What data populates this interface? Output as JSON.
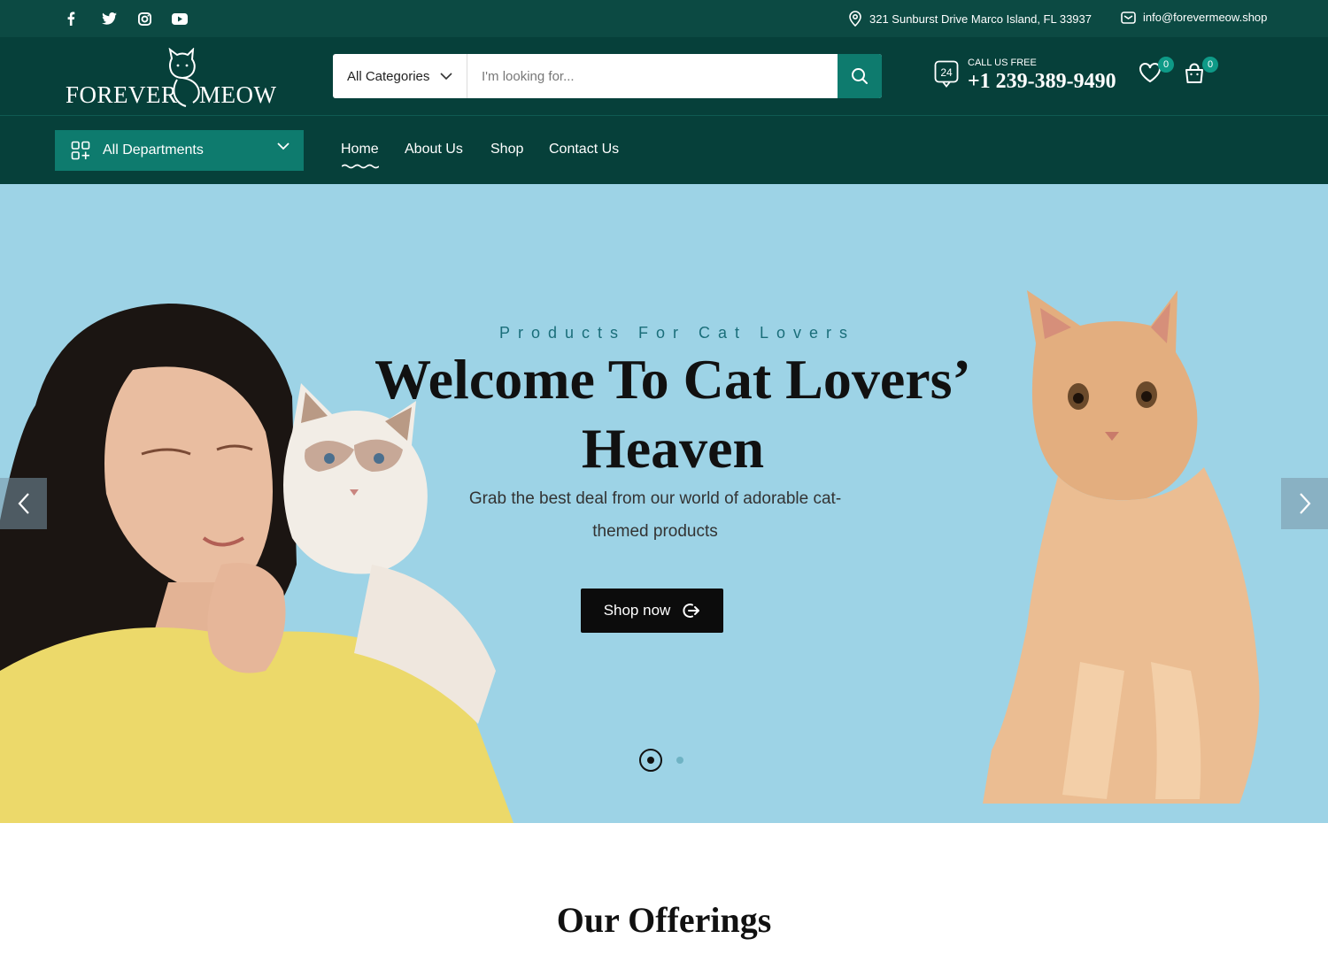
{
  "topbar": {
    "social": [
      "facebook-icon",
      "twitter-icon",
      "instagram-icon",
      "youtube-icon"
    ],
    "address": "321 Sunburst Drive Marco Island, FL 33937",
    "email": "info@forevermeow.shop"
  },
  "header": {
    "logo_left": "FOREVER",
    "logo_right": "MEOW",
    "search": {
      "category": "All Categories",
      "placeholder": "I'm looking for..."
    },
    "call": {
      "badge": "24",
      "label": "CALL US FREE",
      "number": "+1 239-389-9490"
    },
    "wishlist_count": "0",
    "cart_count": "0"
  },
  "nav": {
    "departments": "All Departments",
    "links": [
      "Home",
      "About Us",
      "Shop",
      "Contact Us"
    ],
    "active": "Home"
  },
  "hero": {
    "tagline": "Products For Cat Lovers",
    "title": "Welcome To Cat Lovers’ Heaven",
    "subtitle": "Grab the best deal from our world of adorable cat-themed products",
    "button": "Shop now",
    "slides": 2,
    "active_slide": 1
  },
  "offerings": {
    "title": "Our Offerings"
  },
  "colors": {
    "topbar": "#0c4a43",
    "header": "#06403a",
    "accent": "#0e7b6e",
    "hero_bg": "#9dd3e6"
  }
}
